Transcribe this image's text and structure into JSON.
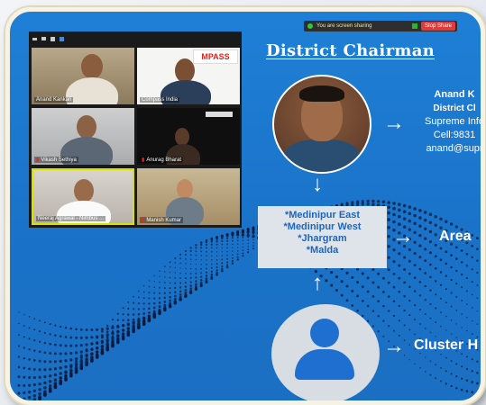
{
  "sharing_bar": {
    "notice": "You are screen sharing",
    "stop_label": "Stop Share"
  },
  "heading": "District Chairman",
  "participants": [
    {
      "name": "Anand Kankari"
    },
    {
      "name": "Compass India"
    },
    {
      "name": "Vikash Sethiya"
    },
    {
      "name": "Anurag Bharat"
    },
    {
      "name": "Neeraj Agrawal - Nimbus ..."
    },
    {
      "name": "Manish Kumar"
    }
  ],
  "banner_logo": "MPASS",
  "chairman": {
    "name": "Anand K",
    "role": "District Cl",
    "company": "Supreme Info",
    "cell": "Cell:9831",
    "email": "anand@supr"
  },
  "areas": [
    "*Medinipur East",
    "*Medinipur West",
    "*Jhargram",
    "*Malda"
  ],
  "area_label": "Area",
  "cluster_label": "Cluster H",
  "colors": {
    "background": "#1a73c9",
    "areas_text": "#1c66c1",
    "areas_box": "#dfe4ea"
  }
}
